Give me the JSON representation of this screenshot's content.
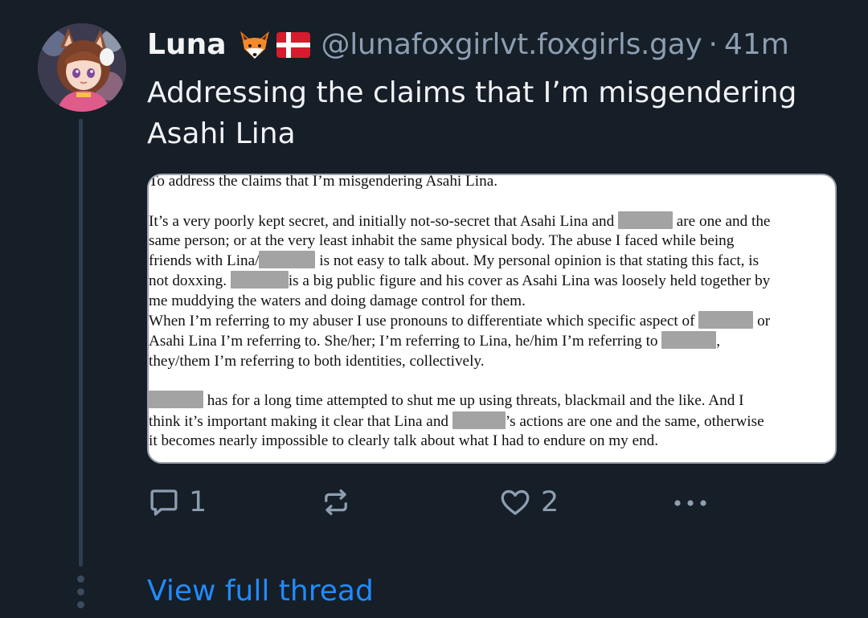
{
  "author": {
    "display_name": "Luna",
    "emoji": [
      "fox-emoji",
      "denmark-flag-emoji"
    ],
    "handle": "@lunafoxgirlvt.foxgirls.gay",
    "separator": "·",
    "timestamp": "41m"
  },
  "post": {
    "text": "Addressing the claims that I’m misgendering Asahi Lina"
  },
  "image": {
    "lines": [
      [
        {
          "t": "To address the claims that I’m misgendering Asahi Lina."
        }
      ],
      [],
      [
        {
          "t": "It’s a very poorly kept secret, and initially not-so-secret that Asahi Lina and "
        },
        {
          "r": 68
        },
        {
          "t": " are one and the"
        }
      ],
      [
        {
          "t": "same person; or at the very least inhabit the same physical body. The abuse I faced while being"
        }
      ],
      [
        {
          "t": "friends with Lina/"
        },
        {
          "r": 70
        },
        {
          "t": " is not easy to talk about. My personal opinion is that stating this fact, is"
        }
      ],
      [
        {
          "t": "not doxxing. "
        },
        {
          "r": 72
        },
        {
          "t": "is a big public figure and his cover as Asahi Lina was loosely held together by"
        }
      ],
      [
        {
          "t": "me muddying the waters and doing damage control for them."
        }
      ],
      [
        {
          "t": "When I’m referring to my abuser I use pronouns to differentiate which specific aspect of "
        },
        {
          "r": 68
        },
        {
          "t": " or"
        }
      ],
      [
        {
          "t": "Asahi Lina I’m referring to. She/her; I’m referring to Lina, he/him I’m referring to "
        },
        {
          "r": 68
        },
        {
          "t": ","
        }
      ],
      [
        {
          "t": "they/them I’m referring to both identities, collectively."
        }
      ],
      [],
      [
        {
          "r": 68
        },
        {
          "t": " has for a long time attempted to shut me up using threats, blackmail and the like. And I"
        }
      ],
      [
        {
          "t": "think it’s important making it clear that Lina and "
        },
        {
          "r": 66
        },
        {
          "t": "’s actions are one and the same, otherwise"
        }
      ],
      [
        {
          "t": "it becomes nearly impossible to clearly talk about what I had to endure on my end."
        }
      ]
    ]
  },
  "actions": {
    "reply_count": "1",
    "repost_count": "",
    "like_count": "2"
  },
  "footer": {
    "view_thread": "View full thread"
  },
  "colors": {
    "background": "#161e27",
    "muted": "#8d9eb1",
    "link": "#208bfe",
    "thread_line": "#2c3d51"
  }
}
